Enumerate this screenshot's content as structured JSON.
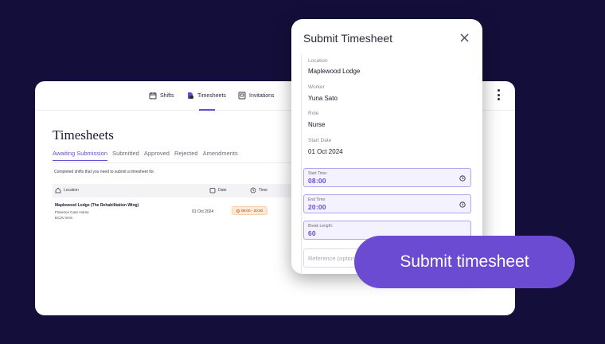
{
  "nav": {
    "items": [
      {
        "label": "Shifts",
        "icon": "calendar-icon"
      },
      {
        "label": "Timesheets",
        "icon": "document-icon"
      },
      {
        "label": "Invitations",
        "icon": "invitation-icon"
      }
    ],
    "active": "Timesheets",
    "accent": "#6a4bd1"
  },
  "page": {
    "title": "Timesheets",
    "tabs": [
      "Awaiting Submission",
      "Submitted",
      "Approved",
      "Rejected",
      "Amendments"
    ],
    "active_tab": "Awaiting Submission",
    "subtitle": "Completed shifts that you need to submit a timesheet for."
  },
  "table": {
    "headers": {
      "location": "Location",
      "date": "Date",
      "time": "Time"
    },
    "rows": [
      {
        "location": "Maplewood Lodge (The Rehabilitation Wing)",
        "location_line2": "Florence Care Home",
        "location_line3": "EC2V 8AS",
        "date": "01 Oct 2024",
        "time": "08:00 - 20:00"
      }
    ]
  },
  "modal": {
    "title": "Submit Timesheet",
    "fields": [
      {
        "label": "Location",
        "value": "Maplewood Lodge"
      },
      {
        "label": "Worker",
        "value": "Yuna Sato"
      },
      {
        "label": "Role",
        "value": "Nurse"
      },
      {
        "label": "Start Date",
        "value": "01 Oct 2024"
      }
    ],
    "start_time": {
      "label": "Start Time:",
      "value": "08:00"
    },
    "end_time": {
      "label": "End Time:",
      "value": "20:00"
    },
    "break_length": {
      "label": "Break Length:",
      "value": "60"
    },
    "reference": {
      "placeholder": "Reference (optional)",
      "value": ""
    }
  },
  "cta": {
    "label": "Submit timesheet",
    "color": "#6a4bd1"
  }
}
